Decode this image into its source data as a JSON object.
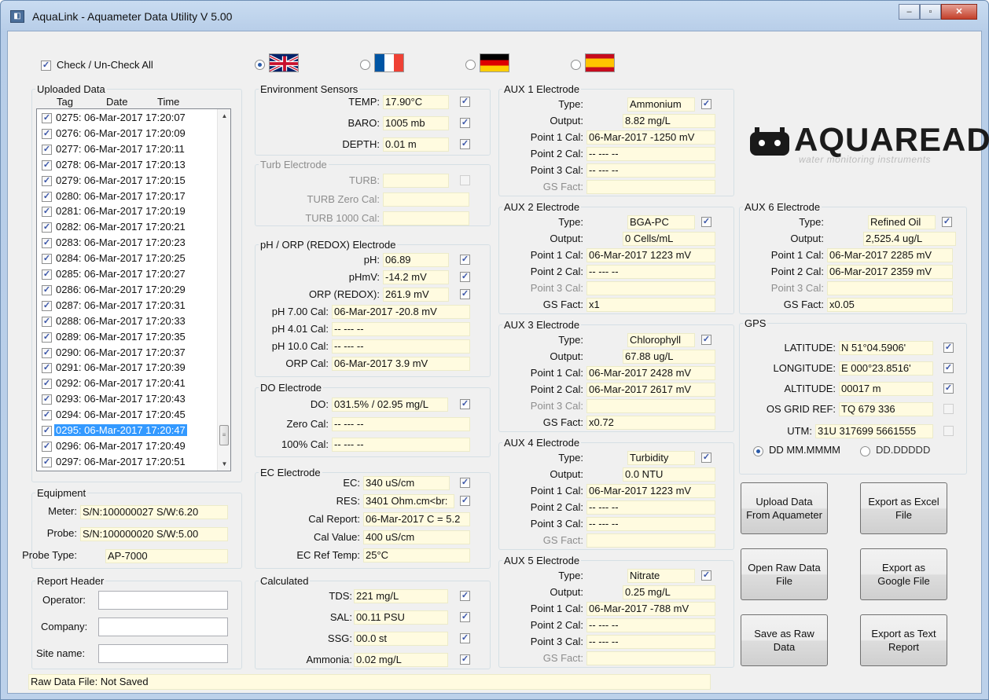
{
  "window": {
    "title": "AquaLink - Aquameter Data Utility V 5.00"
  },
  "check_all": {
    "label": "Check / Un-Check All"
  },
  "uploaded": {
    "legend": "Uploaded Data",
    "col_tag": "Tag",
    "col_date": "Date",
    "col_time": "Time",
    "rows": [
      "0275: 06-Mar-2017 17:20:07",
      "0276: 06-Mar-2017 17:20:09",
      "0277: 06-Mar-2017 17:20:11",
      "0278: 06-Mar-2017 17:20:13",
      "0279: 06-Mar-2017 17:20:15",
      "0280: 06-Mar-2017 17:20:17",
      "0281: 06-Mar-2017 17:20:19",
      "0282: 06-Mar-2017 17:20:21",
      "0283: 06-Mar-2017 17:20:23",
      "0284: 06-Mar-2017 17:20:25",
      "0285: 06-Mar-2017 17:20:27",
      "0286: 06-Mar-2017 17:20:29",
      "0287: 06-Mar-2017 17:20:31",
      "0288: 06-Mar-2017 17:20:33",
      "0289: 06-Mar-2017 17:20:35",
      "0290: 06-Mar-2017 17:20:37",
      "0291: 06-Mar-2017 17:20:39",
      "0292: 06-Mar-2017 17:20:41",
      "0293: 06-Mar-2017 17:20:43",
      "0294: 06-Mar-2017 17:20:45",
      "0295: 06-Mar-2017 17:20:47",
      "0296: 06-Mar-2017 17:20:49",
      "0297: 06-Mar-2017 17:20:51"
    ],
    "selected": "0295: 06-Mar-2017 17:20:47"
  },
  "equipment": {
    "legend": "Equipment",
    "meter_label": "Meter:",
    "meter": "S/N:100000027 S/W:6.20",
    "probe_label": "Probe:",
    "probe": "S/N:100000020 S/W:5.00",
    "probe_type_label": "Probe Type:",
    "probe_type": "AP-7000"
  },
  "report_header": {
    "legend": "Report Header",
    "operator_label": "Operator:",
    "company_label": "Company:",
    "site_label": "Site name:"
  },
  "environment": {
    "legend": "Environment Sensors",
    "temp_label": "TEMP:",
    "temp": "17.90°C",
    "baro_label": "BARO:",
    "baro": "1005 mb",
    "depth_label": "DEPTH:",
    "depth": "0.01 m"
  },
  "turb": {
    "legend": "Turb Electrode",
    "turb_label": "TURB:",
    "zero_label": "TURB Zero Cal:",
    "k_label": "TURB 1000 Cal:"
  },
  "ph": {
    "legend": "pH / ORP (REDOX) Electrode",
    "ph_label": "pH:",
    "ph": "06.89",
    "phmv_label": "pHmV:",
    "phmv": "-14.2 mV",
    "orp_label": "ORP (REDOX):",
    "orp": "261.9 mV",
    "cal7_label": "pH 7.00 Cal:",
    "cal7": "06-Mar-2017  -20.8 mV",
    "cal4_label": "pH 4.01 Cal:",
    "cal4": "-- --- --",
    "cal10_label": "pH 10.0 Cal:",
    "cal10": "-- --- --",
    "orpcal_label": "ORP Cal:",
    "orpcal": "06-Mar-2017  3.9 mV"
  },
  "do": {
    "legend": "DO Electrode",
    "do_label": "DO:",
    "do": "031.5% / 02.95 mg/L",
    "zero_label": "Zero Cal:",
    "zero": "-- --- --",
    "full_label": "100% Cal:",
    "full": "-- --- --"
  },
  "ec": {
    "legend": "EC Electrode",
    "ec_label": "EC:",
    "ec": "340 uS/cm",
    "res_label": "RES:",
    "res": "3401 Ohm.cm<br:",
    "report_label": "Cal Report:",
    "report": "06-Mar-2017 C = 5.2",
    "value_label": "Cal Value:",
    "value": "400 uS/cm",
    "ref_label": "EC Ref Temp:",
    "ref": "25°C"
  },
  "calculated": {
    "legend": "Calculated",
    "tds_label": "TDS:",
    "tds": "221 mg/L",
    "sal_label": "SAL:",
    "sal": "00.11 PSU",
    "ssg_label": "SSG:",
    "ssg": "00.0 st",
    "amm_label": "Ammonia:",
    "amm": "0.02 mg/L"
  },
  "aux_labels": {
    "type": "Type:",
    "output": "Output:",
    "p1": "Point 1 Cal:",
    "p2": "Point 2 Cal:",
    "p3": "Point 3 Cal:",
    "gs": "GS Fact:"
  },
  "aux1": {
    "legend": "AUX 1 Electrode",
    "type": "Ammonium",
    "output": "8.82 mg/L",
    "p1": "06-Mar-2017  -1250 mV",
    "p2": "-- --- --",
    "p3": "-- --- --",
    "gs": ""
  },
  "aux2": {
    "legend": "AUX 2 Electrode",
    "type": "BGA-PC",
    "output": "0 Cells/mL",
    "p1": "06-Mar-2017  1223 mV",
    "p2": "-- --- --",
    "p3": "",
    "gs": "x1"
  },
  "aux3": {
    "legend": "AUX 3 Electrode",
    "type": "Chlorophyll",
    "output": "67.88 ug/L",
    "p1": "06-Mar-2017  2428 mV",
    "p2": "06-Mar-2017  2617 mV",
    "p3": "",
    "gs": "x0.72"
  },
  "aux4": {
    "legend": "AUX 4 Electrode",
    "type": "Turbidity",
    "output": "0.0 NTU",
    "p1": "06-Mar-2017  1223 mV",
    "p2": "-- --- --",
    "p3": "-- --- --",
    "gs": ""
  },
  "aux5": {
    "legend": "AUX 5 Electrode",
    "type": "Nitrate",
    "output": "0.25 mg/L",
    "p1": "06-Mar-2017  -788 mV",
    "p2": "-- --- --",
    "p3": "-- --- --",
    "gs": ""
  },
  "aux6": {
    "legend": "AUX 6 Electrode",
    "type": "Refined Oil",
    "output": "2,525.4 ug/L",
    "p1": "06-Mar-2017  2285 mV",
    "p2": "06-Mar-2017  2359 mV",
    "p3": "",
    "gs": "x0.05"
  },
  "logo": {
    "name": "AQUAREAD",
    "tagline": "water monitoring instruments"
  },
  "gps": {
    "legend": "GPS",
    "lat_label": "LATITUDE:",
    "lat": "N 51°04.5906'",
    "lon_label": "LONGITUDE:",
    "lon": "E 000°23.8516'",
    "alt_label": "ALTITUDE:",
    "alt": "00017 m",
    "os_label": "OS GRID REF:",
    "os": "TQ 679 336",
    "utm_label": "UTM:",
    "utm": "31U 317699 5661555",
    "fmt1": "DD MM.MMMM",
    "fmt2": "DD.DDDDD"
  },
  "buttons": {
    "upload": "Upload Data From Aquameter",
    "excel": "Export as Excel File",
    "open_raw": "Open Raw Data File",
    "google": "Export as Google File",
    "save_raw": "Save as Raw Data",
    "text": "Export as Text Report"
  },
  "status": "Raw Data File: Not Saved",
  "colors": {
    "field_bg": "#fffbe0",
    "selection": "#3399ff",
    "window_frame": "#b9cfe9"
  }
}
